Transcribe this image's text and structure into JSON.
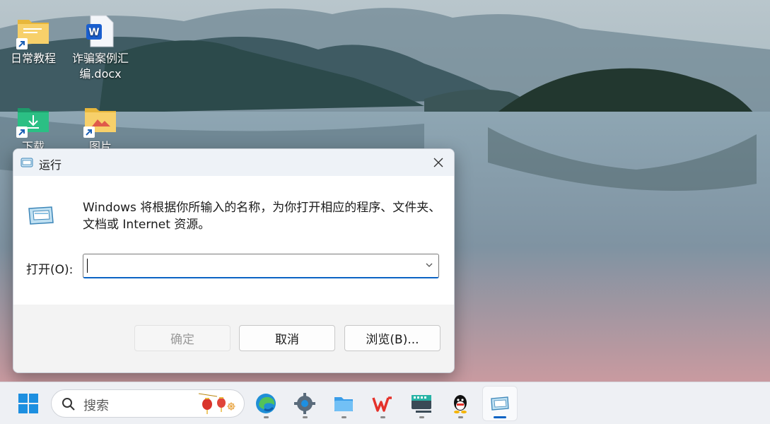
{
  "desktop": {
    "icons": [
      {
        "label": "日常教程"
      },
      {
        "label": "诈骗案例汇编.docx"
      },
      {
        "label": "下载"
      },
      {
        "label": "图片"
      }
    ]
  },
  "dialog": {
    "title": "运行",
    "description": "Windows 将根据你所输入的名称，为你打开相应的程序、文件夹、文档或 Internet 资源。",
    "open_label": "打开(O):",
    "input_value": "",
    "ok_label": "确定",
    "cancel_label": "取消",
    "browse_label": "浏览(B)..."
  },
  "taskbar": {
    "search_placeholder": "搜索",
    "apps": [
      "start-icon",
      "edge-icon",
      "settings-icon",
      "file-explorer-icon",
      "wps-icon",
      "keyboard-app-icon",
      "qq-icon",
      "run-icon"
    ],
    "accent": "#0b63c4"
  }
}
